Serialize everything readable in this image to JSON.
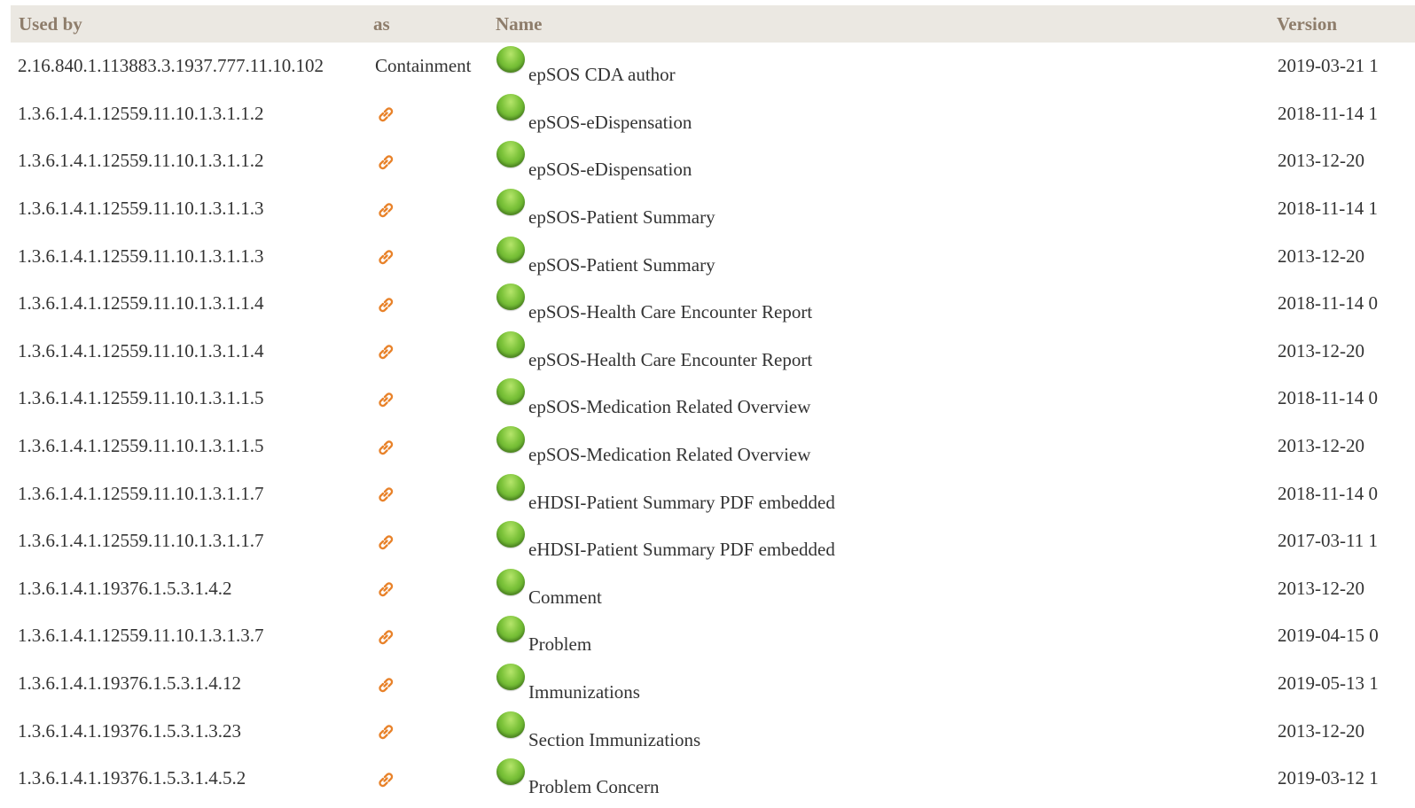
{
  "table": {
    "headers": {
      "used_by": "Used by",
      "as": "as",
      "name": "Name",
      "version": "Version"
    },
    "rows": [
      {
        "used_by": "2.16.840.1.113883.3.1937.777.11.10.102",
        "as": "Containment",
        "as_icon": "",
        "status_icon": "active-status-icon",
        "name": "epSOS CDA author",
        "version": "2019-03-21 1"
      },
      {
        "used_by": "1.3.6.1.4.1.12559.11.10.1.3.1.1.2",
        "as": "",
        "as_icon": "link-icon",
        "status_icon": "active-status-icon",
        "name": "epSOS-eDispensation",
        "version": "2018-11-14 1"
      },
      {
        "used_by": "1.3.6.1.4.1.12559.11.10.1.3.1.1.2",
        "as": "",
        "as_icon": "link-icon",
        "status_icon": "active-status-icon",
        "name": "epSOS-eDispensation",
        "version": "2013-12-20"
      },
      {
        "used_by": "1.3.6.1.4.1.12559.11.10.1.3.1.1.3",
        "as": "",
        "as_icon": "link-icon",
        "status_icon": "active-status-icon",
        "name": "epSOS-Patient Summary",
        "version": "2018-11-14 1"
      },
      {
        "used_by": "1.3.6.1.4.1.12559.11.10.1.3.1.1.3",
        "as": "",
        "as_icon": "link-icon",
        "status_icon": "active-status-icon",
        "name": "epSOS-Patient Summary",
        "version": "2013-12-20"
      },
      {
        "used_by": "1.3.6.1.4.1.12559.11.10.1.3.1.1.4",
        "as": "",
        "as_icon": "link-icon",
        "status_icon": "active-status-icon",
        "name": "epSOS-Health Care Encounter Report",
        "version": "2018-11-14 0"
      },
      {
        "used_by": "1.3.6.1.4.1.12559.11.10.1.3.1.1.4",
        "as": "",
        "as_icon": "link-icon",
        "status_icon": "active-status-icon",
        "name": "epSOS-Health Care Encounter Report",
        "version": "2013-12-20"
      },
      {
        "used_by": "1.3.6.1.4.1.12559.11.10.1.3.1.1.5",
        "as": "",
        "as_icon": "link-icon",
        "status_icon": "active-status-icon",
        "name": "epSOS-Medication Related Overview",
        "version": "2018-11-14 0"
      },
      {
        "used_by": "1.3.6.1.4.1.12559.11.10.1.3.1.1.5",
        "as": "",
        "as_icon": "link-icon",
        "status_icon": "active-status-icon",
        "name": "epSOS-Medication Related Overview",
        "version": "2013-12-20"
      },
      {
        "used_by": "1.3.6.1.4.1.12559.11.10.1.3.1.1.7",
        "as": "",
        "as_icon": "link-icon",
        "status_icon": "active-status-icon",
        "name": "eHDSI-Patient Summary PDF embedded",
        "version": "2018-11-14 0"
      },
      {
        "used_by": "1.3.6.1.4.1.12559.11.10.1.3.1.1.7",
        "as": "",
        "as_icon": "link-icon",
        "status_icon": "active-status-icon",
        "name": "eHDSI-Patient Summary PDF embedded",
        "version": "2017-03-11 1"
      },
      {
        "used_by": "1.3.6.1.4.1.19376.1.5.3.1.4.2",
        "as": "",
        "as_icon": "link-icon",
        "status_icon": "active-status-icon",
        "name": "Comment",
        "version": "2013-12-20"
      },
      {
        "used_by": "1.3.6.1.4.1.12559.11.10.1.3.1.3.7",
        "as": "",
        "as_icon": "link-icon",
        "status_icon": "active-status-icon",
        "name": "Problem",
        "version": "2019-04-15 0"
      },
      {
        "used_by": "1.3.6.1.4.1.19376.1.5.3.1.4.12",
        "as": "",
        "as_icon": "link-icon",
        "status_icon": "active-status-icon",
        "name": "Immunizations",
        "version": "2019-05-13 1"
      },
      {
        "used_by": "1.3.6.1.4.1.19376.1.5.3.1.3.23",
        "as": "",
        "as_icon": "link-icon",
        "status_icon": "active-status-icon",
        "name": "Section Immunizations",
        "version": "2013-12-20"
      },
      {
        "used_by": "1.3.6.1.4.1.19376.1.5.3.1.4.5.2",
        "as": "",
        "as_icon": "link-icon",
        "status_icon": "active-status-icon",
        "name": "Problem Concern",
        "version": "2019-03-12 1"
      }
    ]
  },
  "colors": {
    "header_bg": "#ebe8e2",
    "header_text": "#8e7d6b",
    "body_text": "#333333",
    "link_icon": "#e8822a",
    "status_active": "#7cc33a"
  }
}
